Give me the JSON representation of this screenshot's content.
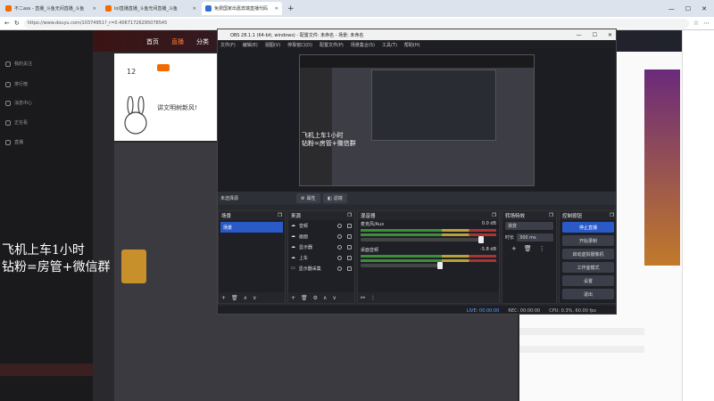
{
  "browser": {
    "tabs": [
      {
        "title": "不二ass - 直播_斗鱼无间直播_斗鱼",
        "color": "#f26b00",
        "active": false
      },
      {
        "title": "lol直播直播_斗鱼无间直播_斗鱼",
        "color": "#f26b00",
        "active": false
      },
      {
        "title": "免费国家出嘉宾端直播代码",
        "color": "#2f6fd6",
        "active": true
      }
    ],
    "new_tab": "+",
    "url": "https://www.douyu.com/10374951?_r=0.40671726295078545"
  },
  "site": {
    "sidebar": [
      {
        "label": "我的关注"
      },
      {
        "label": "排行榜"
      },
      {
        "label": "消息中心"
      },
      {
        "label": "正在看"
      },
      {
        "label": "直播"
      }
    ],
    "nav": [
      "首页",
      "直播",
      "分类"
    ],
    "stats": {
      "count": "12"
    },
    "promo": {
      "headline": "讲文明树新风!"
    },
    "overlay_text": "飞机上车1小时\n钻粉=房管+微信群"
  },
  "obs": {
    "title": "OBS 28.1.1 (64-bit, windows) - 配置文件: 未命名 - 场景: 未命名",
    "menu": [
      "文件(F)",
      "编辑(E)",
      "视图(V)",
      "停靠窗口(D)",
      "配置文件(P)",
      "场景集合(S)",
      "工具(T)",
      "帮助(H)"
    ],
    "source_bar": {
      "label": "未选择源",
      "properties": "属性",
      "filters": "滤镜"
    },
    "scenes": {
      "title": "场景",
      "items": [
        "场景"
      ]
    },
    "sources": {
      "title": "来源",
      "items": [
        "音频",
        "画面",
        "显示器",
        "上车",
        "显示器采集"
      ]
    },
    "mixer": {
      "title": "混音器",
      "channels": [
        {
          "name": "麦克风/Aux",
          "db": "0.0 dB"
        },
        {
          "name": "桌面音频",
          "db": "-5.8 dB"
        }
      ]
    },
    "transitions": {
      "title": "转场特效",
      "type": "渐变",
      "duration_label": "时长",
      "duration": "300 ms"
    },
    "controls": {
      "title": "控制按钮",
      "buttons": [
        "停止直播",
        "开始录制",
        "启动虚拟摄像机",
        "工作室模式",
        "设置",
        "退出"
      ]
    },
    "status": {
      "live": "LIVE: 00:00:00",
      "rec": "REC: 00:00:00",
      "cpu": "CPU: 0.3%, 60.00 fps"
    }
  }
}
